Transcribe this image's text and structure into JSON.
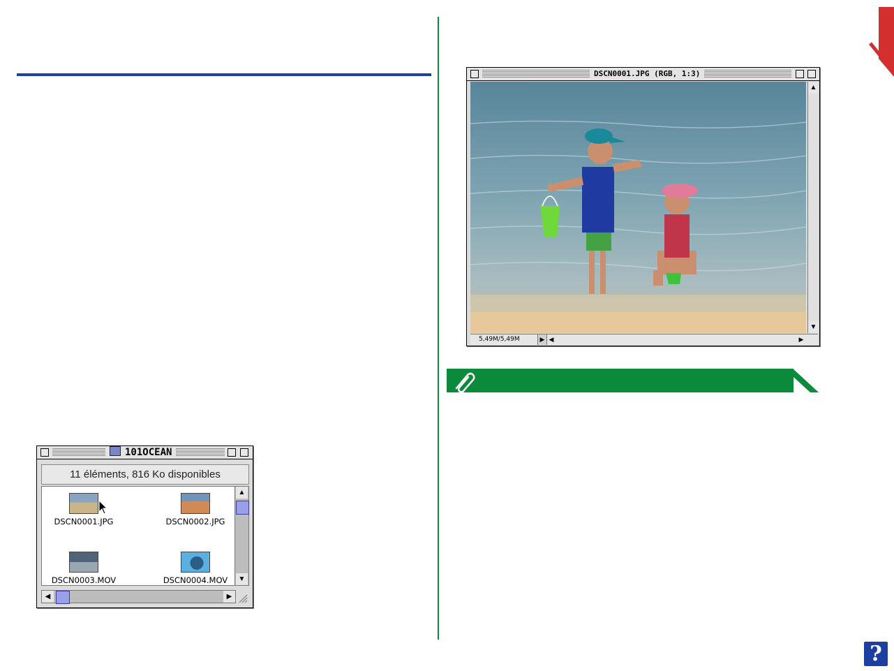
{
  "colors": {
    "blue_rule": "#1f3f9c",
    "green_accent": "#0a8a3a",
    "red_tab": "#d32f2f",
    "help_blue": "#1c3fa0"
  },
  "finder_window": {
    "title": "101OCEAN",
    "info": "11 éléments, 816  Ko disponibles",
    "files": [
      {
        "name": "DSCN0001.JPG",
        "icon": "photo-thumbnail-icon"
      },
      {
        "name": "DSCN0002.JPG",
        "icon": "photo-thumbnail-icon"
      },
      {
        "name": "DSCN0003.MOV",
        "icon": "movie-thumbnail-icon"
      },
      {
        "name": "DSCN0004.MOV",
        "icon": "movie-thumbnail-icon"
      }
    ]
  },
  "photo_window": {
    "title": "DSCN0001.JPG (RGB, 1:3)",
    "memory": "5,49M/5,49M"
  },
  "note": {
    "icon": "paperclip-icon"
  },
  "help": {
    "label": "?"
  }
}
